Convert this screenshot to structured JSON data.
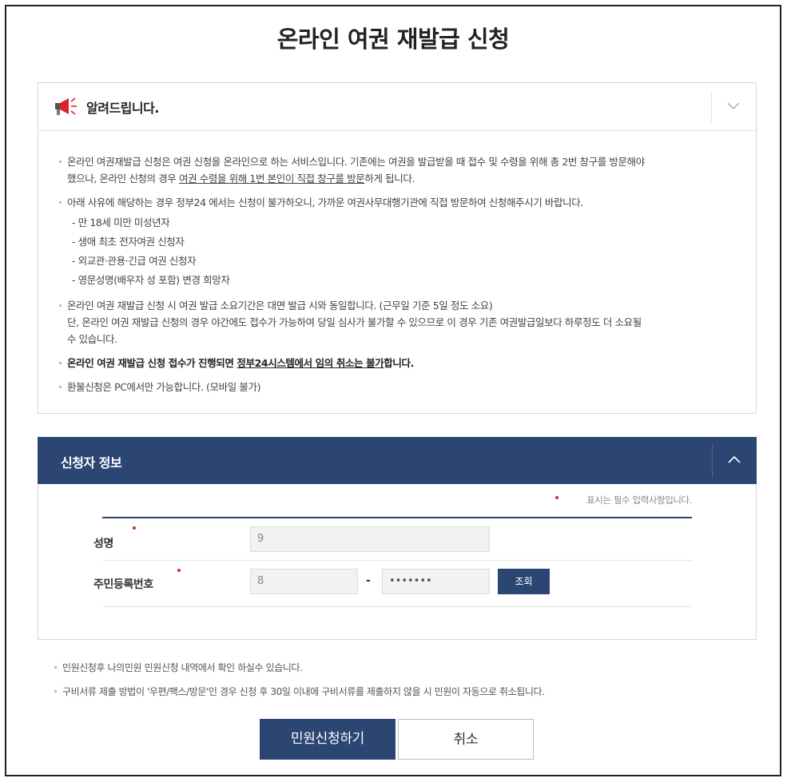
{
  "page": {
    "title": "온라인 여권 재발급 신청"
  },
  "notice": {
    "title": "알려드립니다.",
    "items": [
      "온라인 여권재발급 신청은 여권 신청을 온라인으로 하는 서비스입니다. 기존에는 여권을 발급받을 때 접수 및 수령을 위해 총 2번 창구를 방문해야",
      "했으나, 온라인 신청의 경우 ",
      "여권 수령을 위해 1번 본인이 직접 창구를 방문",
      "하게 됩니다.",
      "아래 사유에 해당하는 경우 정부24 에서는 신청이 불가하오니, 가까운 여권사무대행기관에 직접 방문하여 신청해주시기 바랍니다.",
      "온라인 여권 재발급 신청 시 여권 발급 소요기간은 대면 발급 시와 동일합니다. (근무일 기준 5일 정도 소요)",
      "단, 온라인 여권 재발급 신청의 경우 야간에도 접수가 가능하여 당일 심사가 불가할 수 있으므로 이 경우 기존 여권발급일보다 하루정도 더 소요될",
      "수 있습니다.",
      "온라인 여권 재발급 신청 접수가 진행되면 ",
      "정부24시스템에서 임의 취소는 불가",
      "합니다.",
      "환불신청은 PC에서만 가능합니다. (모바일 불가)"
    ],
    "sub_items": [
      "- 만 18세 미만 미성년자",
      "- 생애 최초 전자여권 신청자",
      "- 외교관·관용·긴급 여권 신청자",
      "- 영문성명(배우자 성 포함) 변경 희망자"
    ]
  },
  "applicant": {
    "title": "신청자 정보",
    "required_note": "표시는 필수 입력사항입니다.",
    "name_label": "성명",
    "name_value": "9",
    "rrn_label": "주민등록번호",
    "rrn_front": "8",
    "rrn_dash": "-",
    "rrn_back": "•••••••",
    "lookup_label": "조회"
  },
  "footnotes": [
    "민원신청후 나의민원 민원신청 내역에서 확인 하실수 있습니다.",
    "구비서류 제출 방법이 '우편/팩스/방문'인 경우 신청 후 30일 이내에 구비서류를 제출하지 않을 시 민원이 자동으로 취소됩니다."
  ],
  "buttons": {
    "submit": "민원신청하기",
    "cancel": "취소"
  },
  "colors": {
    "primary": "#2c4674",
    "required": "#d6262b"
  }
}
